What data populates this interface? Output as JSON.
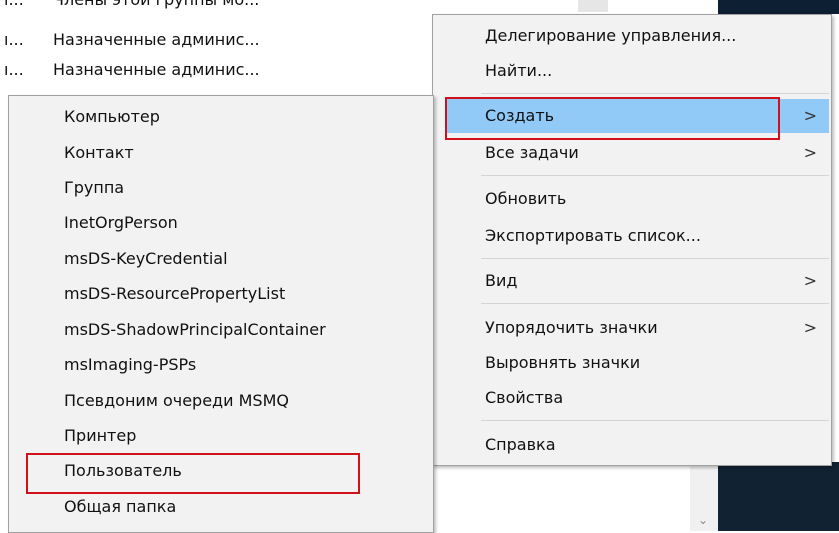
{
  "background_list": {
    "rows": [
      {
        "col1": "ı...",
        "col2": "Члены этой группы мо..."
      },
      {
        "col1": "ı...",
        "col2": "Назначенные админис..."
      },
      {
        "col1": "ı...",
        "col2": "Назначенные админис..."
      }
    ]
  },
  "context_menu": {
    "items": [
      {
        "label": "Делегирование управления..."
      },
      {
        "label": "Найти..."
      },
      {
        "label": "Создать",
        "submenu_arrow": ">"
      },
      {
        "label": "Все задачи",
        "submenu_arrow": ">"
      },
      {
        "label": "Обновить"
      },
      {
        "label": "Экспортировать список..."
      },
      {
        "label": "Вид",
        "submenu_arrow": ">"
      },
      {
        "label": "Упорядочить значки",
        "submenu_arrow": ">"
      },
      {
        "label": "Выровнять значки"
      },
      {
        "label": "Свойства"
      },
      {
        "label": "Справка"
      }
    ]
  },
  "create_submenu": {
    "items": [
      {
        "label": "Компьютер"
      },
      {
        "label": "Контакт"
      },
      {
        "label": "Группа"
      },
      {
        "label": "InetOrgPerson"
      },
      {
        "label": "msDS-KeyCredential"
      },
      {
        "label": "msDS-ResourcePropertyList"
      },
      {
        "label": "msDS-ShadowPrincipalContainer"
      },
      {
        "label": "msImaging-PSPs"
      },
      {
        "label": "Псевдоним очереди MSMQ"
      },
      {
        "label": "Принтер"
      },
      {
        "label": "Пользователь"
      },
      {
        "label": "Общая папка"
      }
    ]
  },
  "scroll_glyph": "⌄",
  "colors": {
    "highlight": "#91c9f7",
    "annotation": "#d0101b",
    "menu_bg": "#f2f2f2"
  }
}
